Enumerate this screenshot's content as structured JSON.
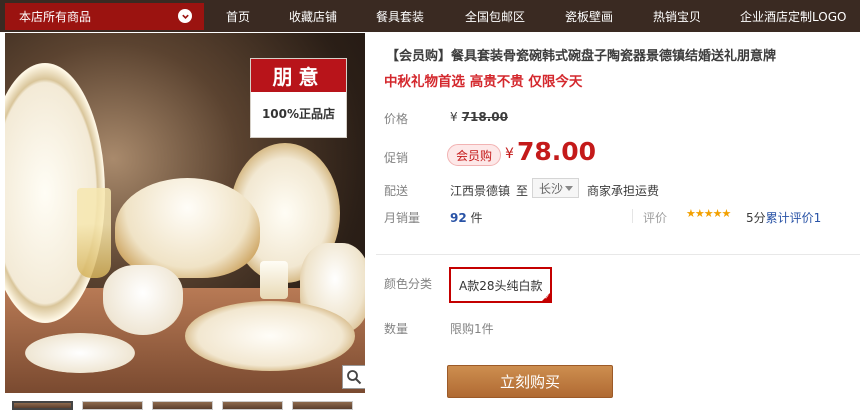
{
  "nav": {
    "all_products": "本店所有商品",
    "items": [
      "首页",
      "收藏店铺",
      "餐具套装",
      "全国包邮区",
      "瓷板壁画",
      "热销宝贝",
      "企业酒店定制LOGO"
    ]
  },
  "gallery": {
    "brand_name": "朋意",
    "brand_tag": "100%正品店",
    "zoom_icon": "magnifier-icon",
    "thumbnail_count": 5
  },
  "product": {
    "title": "【会员购】餐具套装骨瓷碗韩式碗盘子陶瓷器景德镇结婚送礼朋意牌",
    "subtitle": "中秋礼物首选 高贵不贵 仅限今天",
    "price_label": "价格",
    "currency": "¥",
    "original_price": "718.00",
    "promo_label": "促销",
    "member_badge": "会员购",
    "sale_price": "78.00",
    "delivery_label": "配送",
    "origin": "江西景德镇",
    "to": "至",
    "city": "长沙",
    "freight": "商家承担运费",
    "monthly_sales_label": "月销量",
    "monthly_sales": "92",
    "monthly_sales_unit": "件",
    "rating_label": "评价",
    "stars": "★★★★★",
    "rating_score": "5分",
    "rating_count_text": "累计评价1",
    "color_label": "颜色分类",
    "color_option": "A款28头纯白款",
    "quantity_label": "数量",
    "limit_text": "限购1件",
    "buy_button": "立刻购买"
  },
  "colors": {
    "nav_bg": "#3a2a22",
    "category_bg": "#9b1310",
    "price_red": "#c41a1a",
    "link_blue": "#2953a6",
    "buy_button": "#b87536"
  }
}
